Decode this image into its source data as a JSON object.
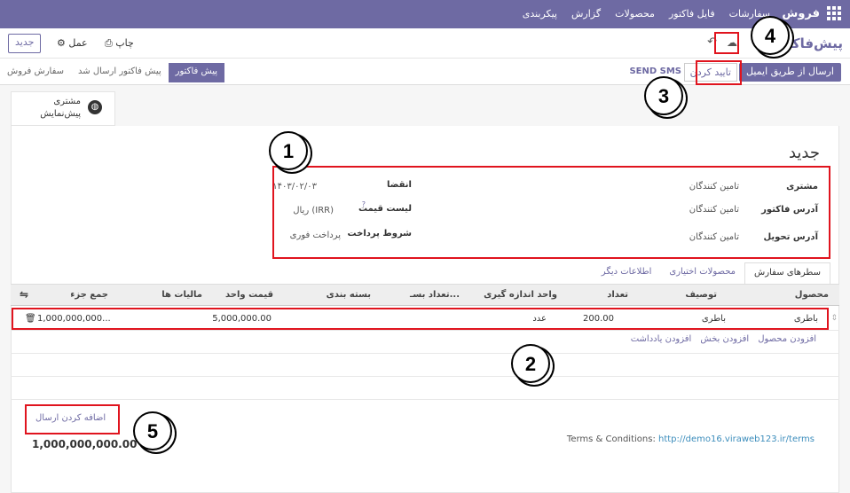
{
  "navbar": {
    "brand": "فروش",
    "menu": [
      "سفارشات",
      "فایل فاکتور",
      "محصولات",
      "گزارش",
      "پیکربندی"
    ]
  },
  "control": {
    "title": "پیش‌فاکتور",
    "new_label": "جدید",
    "action_label": "عمل",
    "print_label": "چاپ"
  },
  "status": {
    "email_button": "ارسال از طریق ایمیل",
    "confirm_button": "تایید کردن",
    "sms_button": "SEND SMS",
    "stages": [
      "پیش فاکتور",
      "پیش فاکتور ارسال شد",
      "سفارش فروش"
    ]
  },
  "smart_button": {
    "line1": "مشتری",
    "line2": "پیش‌نمایش"
  },
  "form": {
    "title": "جدید",
    "customer_label": "مشتری",
    "customer_value": "تامین کنندگان",
    "invoice_address_label": "آدرس فاکتور",
    "invoice_address_value": "تامین کنندگان",
    "delivery_address_label": "آدرس تحویل",
    "delivery_address_value": "تامین کنندگان",
    "expiration_label": "انقضا",
    "expiration_value": "۱۴۰۳/۰۲/۰۳",
    "pricelist_label": "لیست قیمت",
    "pricelist_help": "?",
    "pricelist_value": "ریال (IRR)",
    "payment_terms_label": "شروط پرداخت",
    "payment_terms_value": "پرداخت فوری"
  },
  "tabs": [
    "سطرهای سفارش",
    "محصولات اختیاری",
    "اطلاعات دیگر"
  ],
  "table": {
    "headers": {
      "product": "محصول",
      "description": "توصیف",
      "quantity": "تعداد",
      "uom": "واحد اندازه گیری",
      "packaging_qty": "تعداد بسـ...",
      "packaging": "بسته بندی",
      "unit_price": "قیمت واحد",
      "taxes": "مالیات ها",
      "subtotal": "جمع جزء"
    },
    "row": {
      "product": "باطری",
      "description": "باطری",
      "quantity": "200.00",
      "uom": "عدد",
      "unit_price": "5,000,000.00",
      "subtotal": "1,000,000,000..."
    },
    "add_links": [
      "افزودن محصول",
      "افزودن بخش",
      "افزودن یادداشت"
    ]
  },
  "footer": {
    "terms_label": "Terms & Conditions:",
    "terms_link": "http://demo16.viraweb123.ir/terms",
    "add_shipping": "اضافه کردن ارسال",
    "total": "1,000,000,000.00"
  },
  "callouts": [
    "1",
    "2",
    "3",
    "4",
    "5"
  ],
  "colors": {
    "brand": "#6e6aa3",
    "highlight": "#e0141e"
  }
}
